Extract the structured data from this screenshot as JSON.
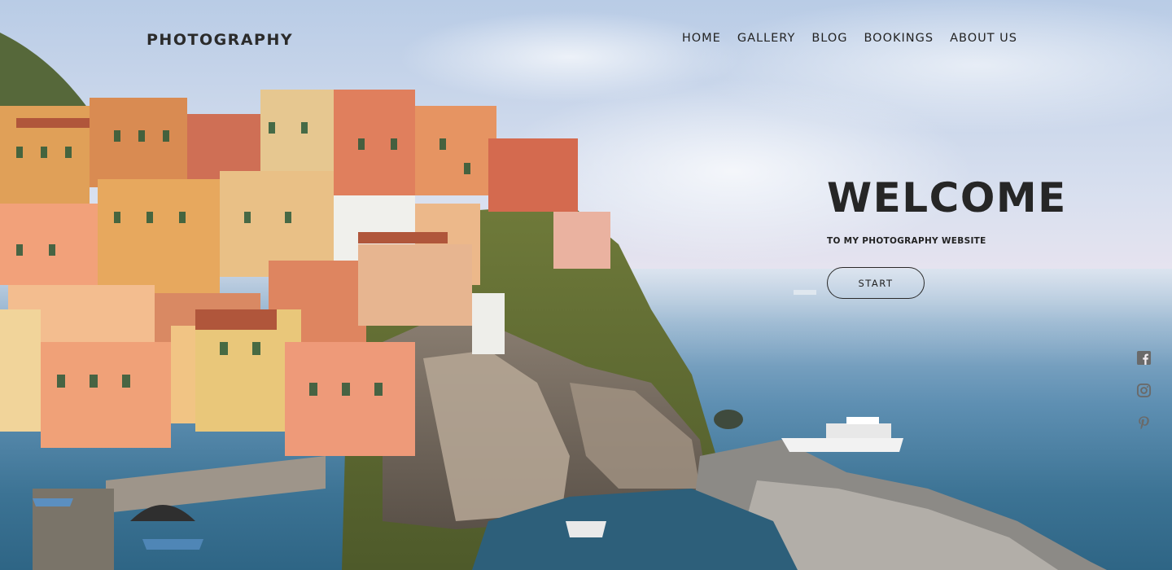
{
  "header": {
    "logo": "PHOTOGRAPHY",
    "nav": [
      {
        "label": "HOME"
      },
      {
        "label": "GALLERY"
      },
      {
        "label": "BLOG"
      },
      {
        "label": "BOOKINGS"
      },
      {
        "label": "ABOUT US"
      }
    ]
  },
  "hero": {
    "title": "WELCOME",
    "subtitle": "TO MY PHOTOGRAPHY WEBSITE",
    "button": "START"
  },
  "social": [
    {
      "icon": "facebook-icon"
    },
    {
      "icon": "instagram-icon"
    },
    {
      "icon": "pinterest-icon"
    }
  ],
  "colors": {
    "text": "#262626",
    "icon": "#6a6a6a"
  }
}
